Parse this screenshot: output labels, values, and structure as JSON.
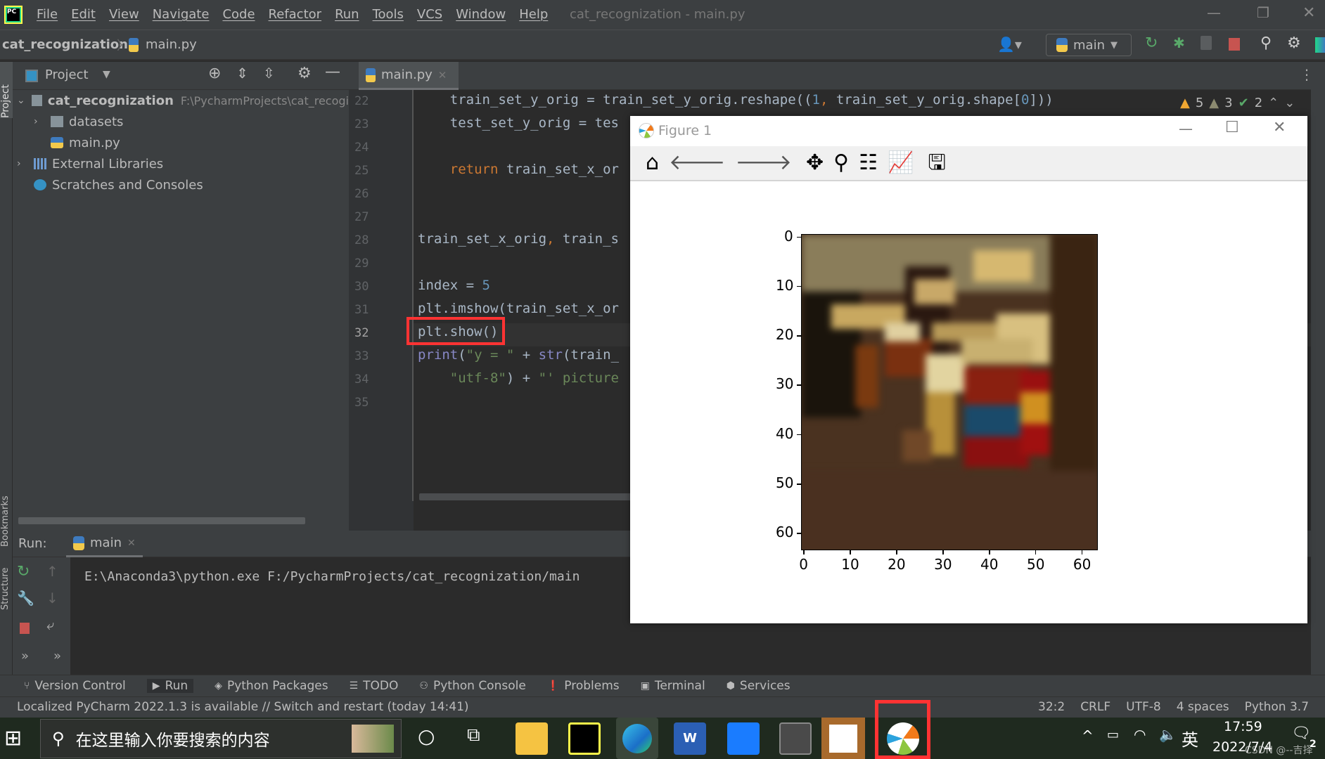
{
  "window": {
    "title": "cat_recognization - main.py",
    "menu": [
      "File",
      "Edit",
      "View",
      "Navigate",
      "Code",
      "Refactor",
      "Run",
      "Tools",
      "VCS",
      "Window",
      "Help"
    ]
  },
  "navbar": {
    "project": "cat_recognization",
    "file": "main.py",
    "run_config": "main"
  },
  "project_panel": {
    "title": "Project",
    "tree": [
      {
        "label": "cat_recognization",
        "path": "F:\\PycharmProjects\\cat_recogi",
        "level": 0,
        "arrow": "down",
        "icon": "folder-icon"
      },
      {
        "label": "datasets",
        "path": "",
        "level": 1,
        "arrow": "right",
        "icon": "folder-icon"
      },
      {
        "label": "main.py",
        "path": "",
        "level": 1,
        "arrow": "",
        "icon": "python-file-icon"
      },
      {
        "label": "External Libraries",
        "path": "",
        "level": 0,
        "arrow": "right",
        "icon": "library-icon"
      },
      {
        "label": "Scratches and Consoles",
        "path": "",
        "level": 0,
        "arrow": "",
        "icon": "scratches-icon"
      }
    ]
  },
  "editor": {
    "tab": "main.py",
    "inspections": {
      "warnings": "5",
      "weak_warnings": "3",
      "typos": "2"
    },
    "current_line": "32",
    "lines": [
      {
        "n": "22",
        "tokens": [
          [
            "    train_set_y_orig = train_set_y_orig.reshape((",
            "#a9b7c6"
          ],
          [
            "1",
            "#6897bb"
          ],
          [
            ", ",
            "#cc7832"
          ],
          [
            "train_set_y_orig.shape[",
            "#a9b7c6"
          ],
          [
            "0",
            "#6897bb"
          ],
          [
            "]))",
            "#a9b7c6"
          ]
        ]
      },
      {
        "n": "23",
        "tokens": [
          [
            "    test_set_y_orig = tes",
            "#a9b7c6"
          ]
        ]
      },
      {
        "n": "24",
        "tokens": []
      },
      {
        "n": "25",
        "tokens": [
          [
            "    ",
            "#a9b7c6"
          ],
          [
            "return",
            "#cc7832"
          ],
          [
            " train_set_x_or",
            "#a9b7c6"
          ]
        ]
      },
      {
        "n": "26",
        "tokens": []
      },
      {
        "n": "27",
        "tokens": []
      },
      {
        "n": "28",
        "tokens": [
          [
            "train_set_x_orig",
            "#a9b7c6"
          ],
          [
            ", ",
            "#cc7832"
          ],
          [
            "train_s",
            "#a9b7c6"
          ]
        ]
      },
      {
        "n": "29",
        "tokens": []
      },
      {
        "n": "30",
        "tokens": [
          [
            "index = ",
            "#a9b7c6"
          ],
          [
            "5",
            "#6897bb"
          ]
        ]
      },
      {
        "n": "31",
        "tokens": [
          [
            "plt.imshow(train_set_x_or",
            "#a9b7c6"
          ]
        ]
      },
      {
        "n": "32",
        "tokens": [
          [
            "plt.show()",
            "#a9b7c6"
          ]
        ]
      },
      {
        "n": "33",
        "tokens": [
          [
            "print",
            "#8888c6"
          ],
          [
            "(",
            "#a9b7c6"
          ],
          [
            "\"y = \"",
            "#6a8759"
          ],
          [
            " + ",
            "#a9b7c6"
          ],
          [
            "str",
            "#8888c6"
          ],
          [
            "(train_",
            "#a9b7c6"
          ]
        ]
      },
      {
        "n": "34",
        "tokens": [
          [
            "    ",
            "#a9b7c6"
          ],
          [
            "\"utf-8\"",
            "#6a8759"
          ],
          [
            ") + ",
            "#a9b7c6"
          ],
          [
            "\"' picture",
            "#6a8759"
          ]
        ]
      },
      {
        "n": "35",
        "tokens": []
      }
    ]
  },
  "run": {
    "label": "Run:",
    "tab": "main",
    "command": "E:\\Anaconda3\\python.exe F:/PycharmProjects/cat_recognization/main"
  },
  "bottom_tools": [
    "Version Control",
    "Run",
    "Python Packages",
    "TODO",
    "Python Console",
    "Problems",
    "Terminal",
    "Services"
  ],
  "status": {
    "message": "Localized PyCharm 2022.1.3 is available // Switch and restart (today 14:41)",
    "position": "32:2",
    "line_sep": "CRLF",
    "encoding": "UTF-8",
    "indent": "4 spaces",
    "interpreter": "Python 3.7"
  },
  "figure": {
    "title": "Figure 1",
    "toolbar": [
      "home-icon",
      "back-icon",
      "forward-icon",
      "pan-icon",
      "zoom-icon",
      "configure-subplots-icon",
      "edit-axes-icon",
      "save-icon"
    ]
  },
  "chart_data": {
    "type": "heatmap",
    "description_type": "image",
    "xticks": [
      "0",
      "10",
      "20",
      "30",
      "40",
      "50",
      "60"
    ],
    "yticks": [
      "0",
      "10",
      "20",
      "30",
      "40",
      "50",
      "60"
    ],
    "xlim": [
      -0.5,
      63.5
    ],
    "ylim": [
      63.5,
      -0.5
    ]
  },
  "taskbar": {
    "search_placeholder": "在这里输入你要搜索的内容",
    "time": "17:59",
    "date": "2022/7/4",
    "ime": "英",
    "notifications": "2",
    "watermark": "CSDN @--吉择"
  },
  "accent": {
    "highlight": "#ff3333"
  }
}
